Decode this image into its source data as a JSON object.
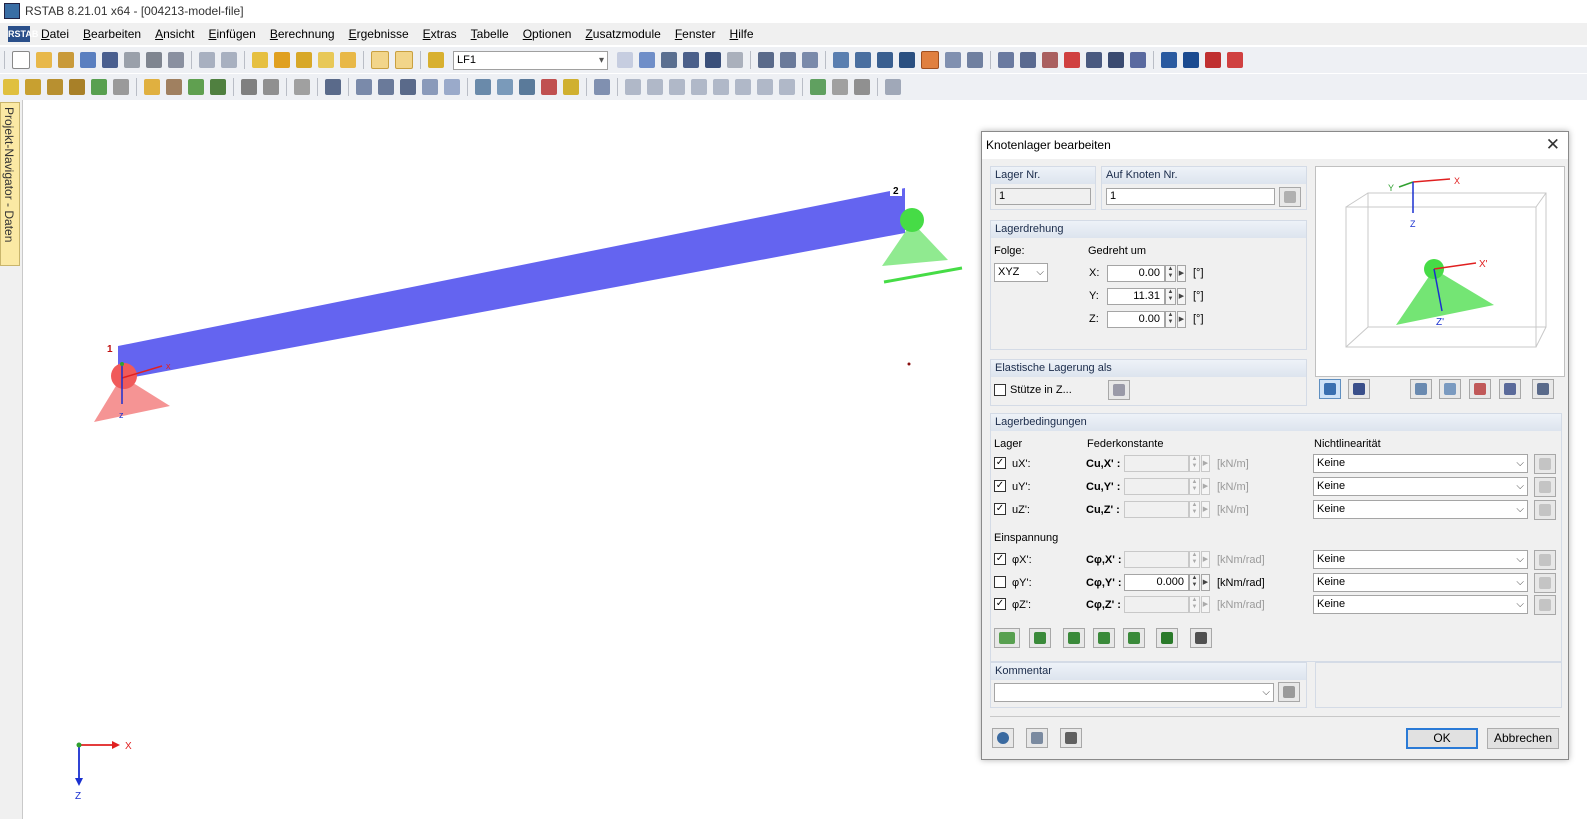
{
  "app": {
    "title": "RSTAB 8.21.01 x64 - [004213-model-file]"
  },
  "menu": {
    "logo": "RSTAB",
    "items": [
      "Datei",
      "Bearbeiten",
      "Ansicht",
      "Einfügen",
      "Berechnung",
      "Ergebnisse",
      "Extras",
      "Tabelle",
      "Optionen",
      "Zusatzmodule",
      "Fenster",
      "Hilfe"
    ]
  },
  "toolbar": {
    "loadcase": "LF1"
  },
  "navigator": {
    "tab": "Projekt-Navigator - Daten"
  },
  "model": {
    "node1_label": "1",
    "node2_label": "2",
    "local_x": "x",
    "local_z": "z",
    "global_x": "X",
    "global_z": "Z",
    "member_color": "#6464f0",
    "support1_color": "#f05a5a",
    "support2_color": "#46dc46"
  },
  "dialog": {
    "title": "Knotenlager bearbeiten",
    "close": "✕",
    "lager_nr": {
      "header": "Lager Nr.",
      "value": "1"
    },
    "auf_knoten": {
      "header": "Auf Knoten Nr.",
      "value": "1"
    },
    "lagerdrehung": {
      "header": "Lagerdrehung",
      "folge_label": "Folge:",
      "folge_value": "XYZ",
      "gedreht_label": "Gedreht um",
      "x_label": "X:",
      "x_value": "0.00",
      "y_label": "Y:",
      "y_value": "11.31",
      "z_label": "Z:",
      "z_value": "0.00",
      "unit": "[°]"
    },
    "elastisch": {
      "header": "Elastische Lagerung als",
      "checkbox_label": "Stütze in Z..."
    },
    "preview": {
      "axis_x": "X",
      "axis_y": "Y",
      "axis_z": "Z",
      "axis_x2": "X'",
      "axis_z2": "Z'"
    },
    "bedingungen": {
      "header": "Lagerbedingungen",
      "col_lager": "Lager",
      "col_feder": "Federkonstante",
      "col_nonlin": "Nichtlinearität",
      "einspannung": "Einspannung",
      "rows": [
        {
          "label": "uX':",
          "checked": true,
          "const": "Cu,X' :",
          "value": "",
          "unit": "[kN/m]",
          "nonlin": "Keine"
        },
        {
          "label": "uY':",
          "checked": true,
          "const": "Cu,Y' :",
          "value": "",
          "unit": "[kN/m]",
          "nonlin": "Keine"
        },
        {
          "label": "uZ':",
          "checked": true,
          "const": "Cu,Z' :",
          "value": "",
          "unit": "[kN/m]",
          "nonlin": "Keine"
        },
        {
          "label": "φX':",
          "checked": true,
          "const": "Cφ,X' :",
          "value": "",
          "unit": "[kNm/rad]",
          "nonlin": "Keine"
        },
        {
          "label": "φY':",
          "checked": false,
          "const": "Cφ,Y' :",
          "value": "0.000",
          "unit": "[kNm/rad]",
          "nonlin": "Keine"
        },
        {
          "label": "φZ':",
          "checked": true,
          "const": "Cφ,Z' :",
          "value": "",
          "unit": "[kNm/rad]",
          "nonlin": "Keine"
        }
      ]
    },
    "kommentar": {
      "header": "Kommentar",
      "value": ""
    },
    "ok": "OK",
    "cancel": "Abbrechen"
  }
}
